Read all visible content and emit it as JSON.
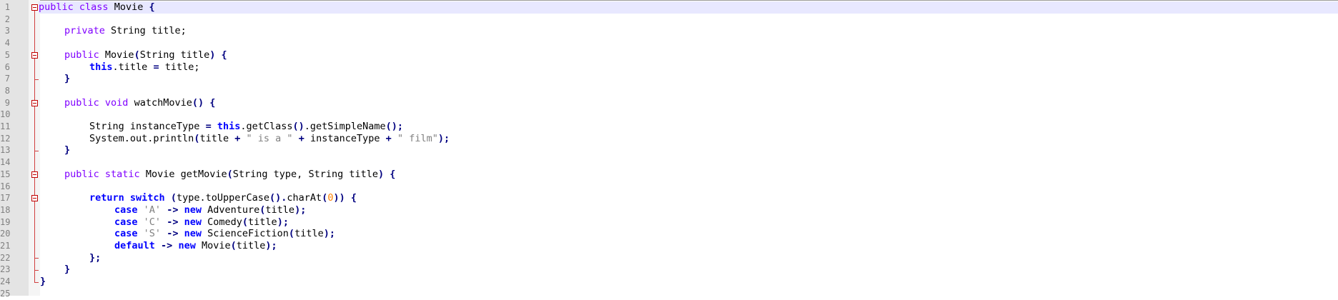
{
  "editor": {
    "line_numbers": [
      "1",
      "2",
      "3",
      "4",
      "5",
      "6",
      "7",
      "8",
      "9",
      "10",
      "11",
      "12",
      "13",
      "14",
      "15",
      "16",
      "17",
      "18",
      "19",
      "20",
      "21",
      "22",
      "23",
      "24",
      "25"
    ],
    "code": {
      "l1": {
        "kw1": "public",
        "kw2": "class",
        "name": "Movie",
        "brace": "{"
      },
      "l3": {
        "kw1": "private",
        "type": "String",
        "rest": "title;"
      },
      "l5": {
        "kw1": "public",
        "name": "Movie",
        "p1": "(",
        "type": "String",
        "arg": "title",
        "p2": ")",
        "brace": "{"
      },
      "l6": {
        "kw": "this",
        "rest1": ".title",
        "eq": "=",
        "rest2": "title;"
      },
      "l7": {
        "brace": "}"
      },
      "l9": {
        "kw1": "public",
        "kw2": "void",
        "name": "watchMovie",
        "parens": "()",
        "brace": "{"
      },
      "l11": {
        "a": "String instanceType",
        "eq": "=",
        "kw": "this",
        "b": ".getClass",
        "p1": "()",
        "c": ".getSimpleName",
        "p2": "();"
      },
      "l12": {
        "a": "System.out.println",
        "p1": "(",
        "b": "title",
        "plus1": "+",
        "s1": "\" is a \"",
        "plus2": "+",
        "c": "instanceType",
        "plus3": "+",
        "s2": "\" film\"",
        "p2": ");"
      },
      "l13": {
        "brace": "}"
      },
      "l15": {
        "kw1": "public",
        "kw2": "static",
        "a": "Movie getMovie",
        "p1": "(",
        "b": "String type, String title",
        "p2": ")",
        "brace": "{"
      },
      "l17": {
        "kw1": "return",
        "kw2": "switch",
        "p1": "(",
        "a": "type.toUpperCase",
        "p2": "().",
        "b": "charAt",
        "p3": "(",
        "num": "0",
        "p4": "))",
        "brace": "{"
      },
      "l18": {
        "kw": "case",
        "s": "'A'",
        "arrow": "->",
        "new": "new",
        "cls": "Adventure",
        "p1": "(",
        "arg": "title",
        "p2": ");"
      },
      "l19": {
        "kw": "case",
        "s": "'C'",
        "arrow": "->",
        "new": "new",
        "cls": "Comedy",
        "p1": "(",
        "arg": "title",
        "p2": ");"
      },
      "l20": {
        "kw": "case",
        "s": "'S'",
        "arrow": "->",
        "new": "new",
        "cls": "ScienceFiction",
        "p1": "(",
        "arg": "title",
        "p2": ");"
      },
      "l21": {
        "kw": "default",
        "arrow": "->",
        "new": "new",
        "cls": "Movie",
        "p1": "(",
        "arg": "title",
        "p2": ");"
      },
      "l22": {
        "brace": "};"
      },
      "l23": {
        "brace": "}"
      },
      "l24": {
        "brace": "}"
      }
    },
    "colors": {
      "keyword": "#8000ff",
      "instruction": "#0000ff",
      "operator": "#000080",
      "string": "#808080",
      "number": "#ff8000",
      "fold": "#c00000"
    }
  }
}
